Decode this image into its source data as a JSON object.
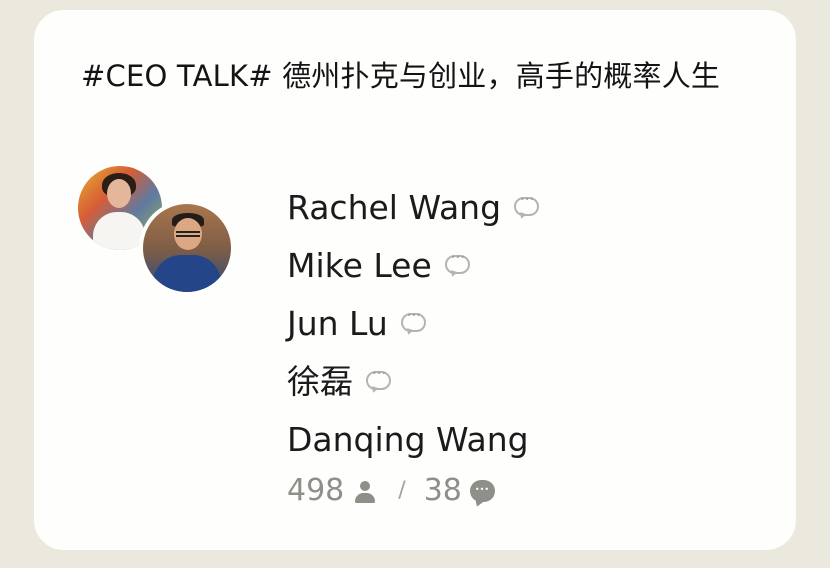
{
  "room": {
    "title": "#CEO TALK# 德州扑克与创业，高手的概率人生"
  },
  "avatars": [
    {
      "name": "avatar-woman",
      "icon": "avatar-icon"
    },
    {
      "name": "avatar-man",
      "icon": "avatar-icon"
    }
  ],
  "speakers": [
    {
      "name": "Rachel Wang",
      "icon": "chat-bubble-icon"
    },
    {
      "name": "Mike Lee",
      "icon": "chat-bubble-icon"
    },
    {
      "name": "Jun Lu",
      "icon": "chat-bubble-icon"
    },
    {
      "name": "徐磊",
      "icon": "chat-bubble-icon"
    },
    {
      "name": "Danqing Wang"
    }
  ],
  "stats": {
    "listeners": "498",
    "listeners_icon": "person-icon",
    "separator": "/",
    "comments": "38",
    "comments_icon": "comment-icon"
  },
  "colors": {
    "page_background": "#ebe8de",
    "card_background": "#fefefd",
    "primary_text": "#1b1b1b",
    "secondary_text": "#8f8f89",
    "muted_icon": "#b4b4b0"
  }
}
